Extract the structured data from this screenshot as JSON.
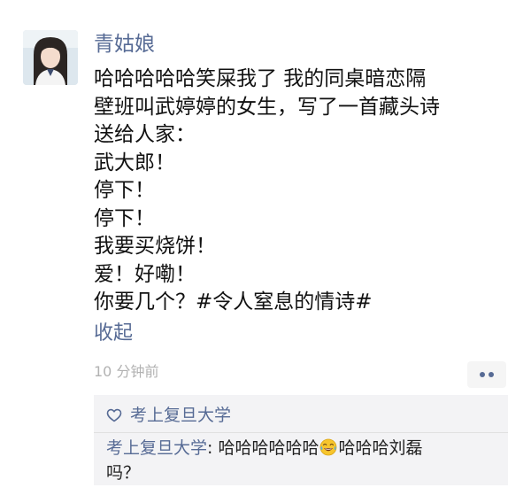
{
  "post": {
    "author": "青姑娘",
    "lines": [
      "哈哈哈哈哈笑屎我了 我的同桌暗恋隔",
      "壁班叫武婷婷的女生，写了一首藏头诗",
      "送给人家：",
      "武大郎！",
      "停下！",
      "停下！",
      "我要买烧饼！",
      "爱！好嘞！",
      "你要几个？#令人窒息的情诗#"
    ],
    "collapse_label": "收起",
    "timestamp": "10 分钟前",
    "more_icon": "ellipsis-icon"
  },
  "interactions": {
    "like_icon": "heart-outline-icon",
    "likes": [
      "考上复旦大学"
    ],
    "comments": [
      {
        "author": "考上复旦大学",
        "separator": ": ",
        "text_before": "哈哈哈哈哈哈",
        "emoji": "laughing-tears-emoji",
        "text_line1_after": "哈哈哈刘磊",
        "text_line2": "吗？"
      }
    ]
  },
  "colors": {
    "link": "#576b95",
    "text": "#111111",
    "muted": "#b2b2b2",
    "panel": "#f3f3f5"
  }
}
